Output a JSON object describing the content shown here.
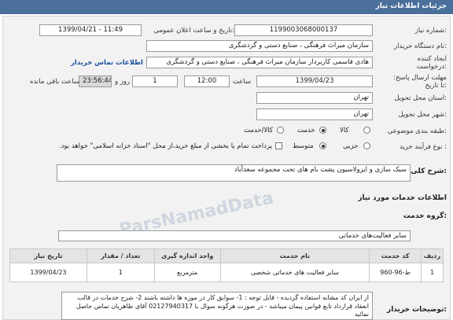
{
  "header": {
    "title": "جزئیات اطلاعات نیاز"
  },
  "form": {
    "need_number_label": "شماره نیاز:",
    "need_number": "1199003068000137",
    "announce_label": "تاریخ و ساعت اعلان عمومی:",
    "announce_value": "1399/04/21 - 11:49",
    "buyer_label": "نام دستگاه خریدار:",
    "buyer_value": "سازمان میراث فرهنگی ، صنایع دستی و گردشگری",
    "creator_label": "ایجاد کننده درخواست:",
    "creator_value": "هادی قاسمی کاربردار سازمان میراث فرهنگی ، صنایع دستی و گردشگری",
    "contact_link": "اطلاعات تماس خریدار",
    "deadline_label": "مهلت ارسال پاسخ: تا تاریخ:",
    "deadline_date": "1399/04/23",
    "time_label": "ساعت",
    "deadline_time": "12:00",
    "days_value": "1",
    "days_label": "روز و",
    "remaining_time": "23:56:44",
    "remaining_label": "ساعت باقی مانده",
    "province_label": "استان محل تحویل:",
    "province_value": "تهران",
    "city_label": "شهر محل تحویل:",
    "city_value": "تهران",
    "category_label": "طبقه بندی موضوعی:",
    "category_options": [
      "کالا",
      "خدمت",
      "کالا/خدمت"
    ],
    "process_label": "نوع فرآیند خرید :",
    "process_options": [
      "جزیی",
      "متوسط"
    ],
    "payment_note": "پرداخت تمام یا بخشی از مبلغ خرید،از محل \"اسناد خزانه اسلامی\" خواهد بود."
  },
  "need_summary": {
    "label": "شرح کلی نیاز:",
    "value": "سبک سازی و ایزولاسیون پشت بام های تحت مجموعه سعدآباد"
  },
  "services": {
    "section_title": "اطلاعات خدمات مورد نیاز",
    "group_label": "گروه خدمت:",
    "group_value": "سایر فعالیت‌های خدماتی"
  },
  "table": {
    "headers": [
      "ردیف",
      "کد خدمت",
      "نام خدمت",
      "واحد اندازه گیری",
      "تعداد / مقدار",
      "تاریخ نیاز"
    ],
    "rows": [
      [
        "1",
        "ط-96-960",
        "سایر فعالیت های خدماتی شخصی",
        "مترمربع",
        "1",
        "1399/04/23"
      ]
    ]
  },
  "buyer_notes": {
    "label": "توضیحات خریدار:",
    "text": "از ایران کد مشابه استفاده گردیده - قابل توجه : 1- سوابق کار در موزه ها داشته باشند 2- شرح خدمات در قالب انعقاد قرارداد تابع قوانین پیمان میباشد - در صورت هرگونه سوال با 02127940317 آقای طاهریان تماس حاصل نمائید"
  },
  "watermark": "ParsNamadData"
}
